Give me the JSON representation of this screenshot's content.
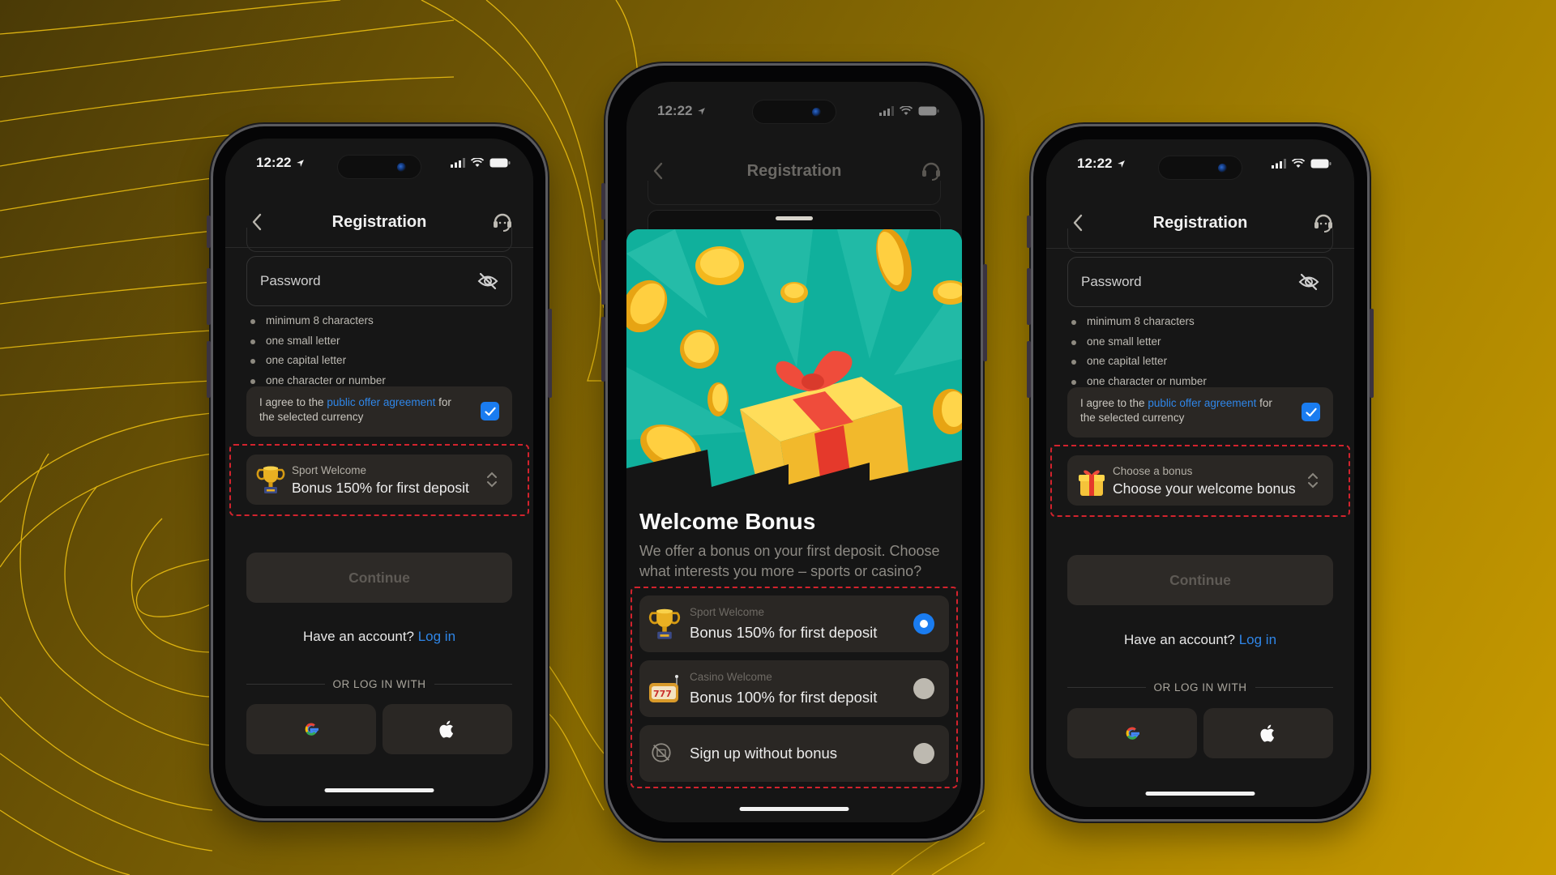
{
  "status_bar": {
    "time": "12:22"
  },
  "screens": [
    {
      "id": "left",
      "nav": {
        "title": "Registration"
      },
      "password_field": {
        "placeholder": "Password"
      },
      "password_rules": [
        "minimum 8 characters",
        "one small letter",
        "one capital letter",
        "one character or number"
      ],
      "agreement": {
        "prefix": "I agree to the ",
        "link": "public offer agreement",
        "suffix": " for the selected currency",
        "checked": true
      },
      "bonus_select": {
        "label": "Sport Welcome",
        "value": "Bonus 150% for first deposit",
        "icon": "trophy-icon"
      },
      "continue_label": "Continue",
      "have_account": {
        "text": "Have an account? ",
        "link": "Log in"
      },
      "or_login_with": "OR LOG IN WITH",
      "social": [
        "google-icon",
        "apple-icon"
      ]
    },
    {
      "id": "center",
      "nav": {
        "title": "Registration"
      },
      "sheet": {
        "title": "Welcome Bonus",
        "description": "We offer a bonus on your first deposit. Choose what interests you more – sports or casino?",
        "options": [
          {
            "label": "Sport Welcome",
            "value": "Bonus 150% for first deposit",
            "icon": "trophy-icon",
            "selected": true
          },
          {
            "label": "Casino Welcome",
            "value": "Bonus 100% for first deposit",
            "icon": "slot-machine-icon",
            "selected": false
          },
          {
            "label": "",
            "value": "Sign up without bonus",
            "icon": "no-bonus-icon",
            "selected": false
          }
        ]
      }
    },
    {
      "id": "right",
      "nav": {
        "title": "Registration"
      },
      "password_field": {
        "placeholder": "Password"
      },
      "password_rules": [
        "minimum 8 characters",
        "one small letter",
        "one capital letter",
        "one character or number"
      ],
      "agreement": {
        "prefix": "I agree to the ",
        "link": "public offer agreement",
        "suffix": " for the selected currency",
        "checked": true
      },
      "bonus_select": {
        "label": "Choose a bonus",
        "value": "Choose your welcome bonus",
        "icon": "gift-icon"
      },
      "continue_label": "Continue",
      "have_account": {
        "text": "Have an account? ",
        "link": "Log in"
      },
      "or_login_with": "OR LOG IN WITH",
      "social": [
        "google-icon",
        "apple-icon"
      ]
    }
  ],
  "colors": {
    "accent_blue": "#1a7cf0",
    "link_blue": "#2f86e8",
    "highlight_red": "#d2232d",
    "banner_teal": "#10b09c",
    "background_gold": "#c99b00"
  }
}
